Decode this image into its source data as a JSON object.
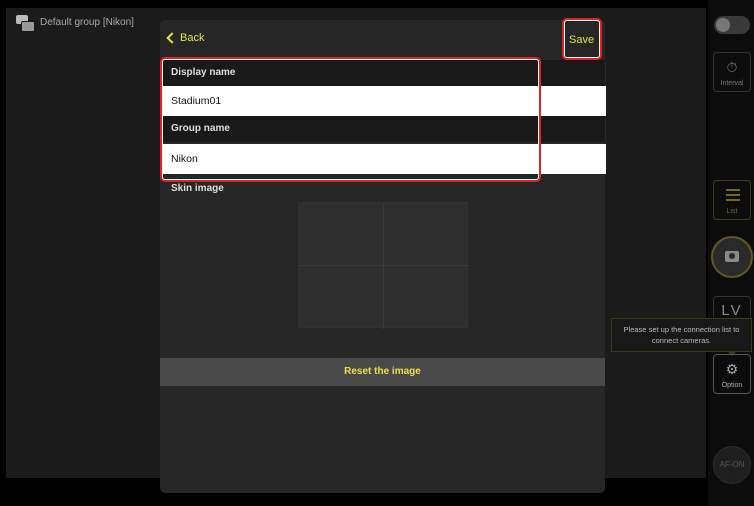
{
  "group_header": {
    "title": "Default group [Nikon]",
    "icon": "camera-group-icon"
  },
  "modal": {
    "back_label": "Back",
    "save_label": "Save",
    "display_name_label": "Display name",
    "display_name_value": "Stadium01",
    "group_name_label": "Group name",
    "group_name_value": "Nikon",
    "skin_image_label": "Skin image",
    "reset_label": "Reset the image"
  },
  "right_bar": {
    "interval_label": "Interval",
    "list_label": "List",
    "lv_label": "LV",
    "option_label": "Option",
    "afon_label": "AF-ON"
  },
  "tooltip": {
    "text_line1": "Please set up the connection list to",
    "text_line2": "connect cameras."
  },
  "colors": {
    "accent": "#e6e24a",
    "highlight": "#e02424",
    "background": "#1b1b1b",
    "modal": "#262626"
  }
}
